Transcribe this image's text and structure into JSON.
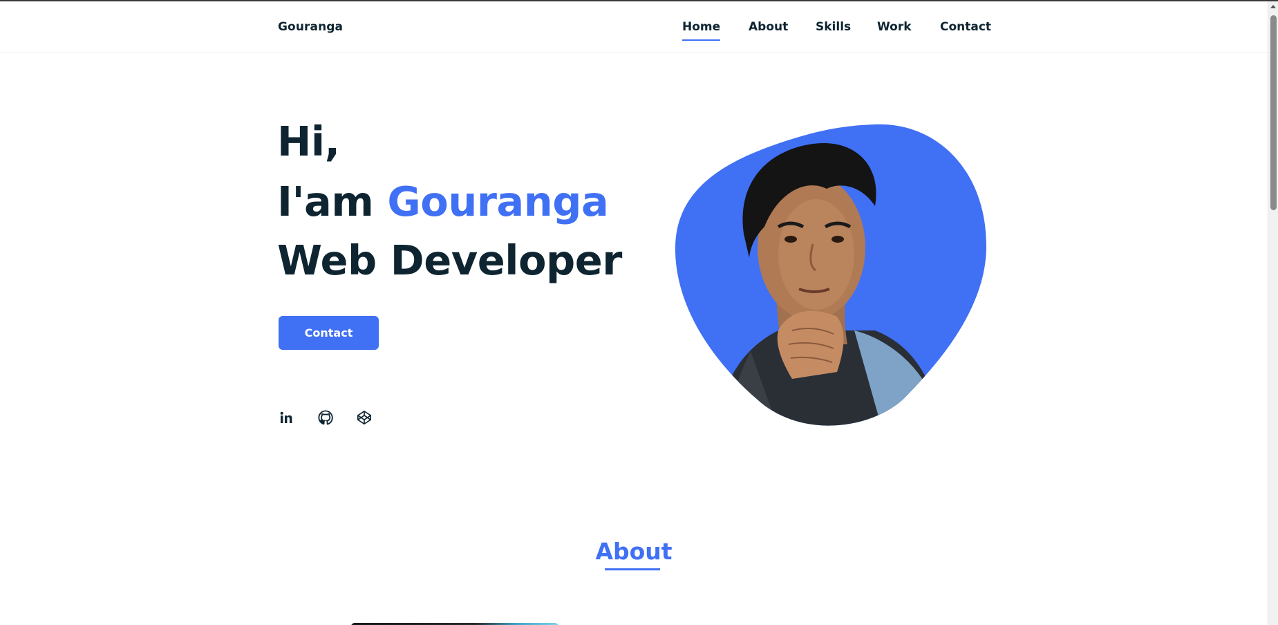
{
  "header": {
    "logo": "Gouranga",
    "nav": [
      {
        "label": "Home",
        "active": true
      },
      {
        "label": "About",
        "active": false
      },
      {
        "label": "Skills",
        "active": false
      },
      {
        "label": "Work",
        "active": false
      },
      {
        "label": "Contact",
        "active": false
      }
    ]
  },
  "hero": {
    "line1": "Hi,",
    "line2_prefix": "I'am",
    "name": "Gouranga",
    "line3": "Web Developer",
    "button": "Contact",
    "social_icons": [
      "linkedin-icon",
      "github-icon",
      "codepen-icon"
    ],
    "blob_color": "#4070f4"
  },
  "about": {
    "title": "About"
  },
  "colors": {
    "accent": "#4070f4",
    "text": "#0e2431"
  }
}
